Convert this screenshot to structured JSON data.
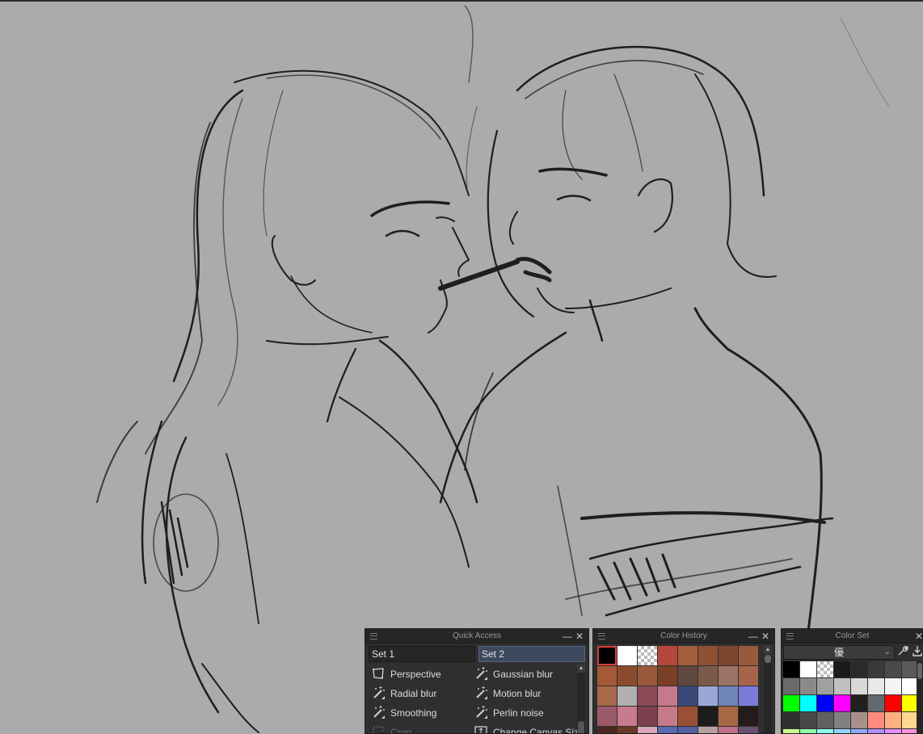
{
  "quick_access": {
    "title": "Quick Access",
    "minimize": "—",
    "close": "✕",
    "tabs": [
      "Set 1",
      "Set 2"
    ],
    "items": [
      {
        "label": "Perspective",
        "icon": "perspective-icon"
      },
      {
        "label": "Gaussian blur",
        "icon": "magic-wand-icon"
      },
      {
        "label": "Radial blur",
        "icon": "magic-wand-icon"
      },
      {
        "label": "Motion blur",
        "icon": "magic-wand-icon"
      },
      {
        "label": "Smoothing",
        "icon": "magic-wand-icon"
      },
      {
        "label": "Perlin noise",
        "icon": "magic-wand-icon"
      },
      {
        "label": "Crop",
        "icon": "crop-icon"
      },
      {
        "label": "Change Canvas Size",
        "icon": "canvas-size-icon"
      }
    ]
  },
  "color_history": {
    "title": "Color History",
    "minimize": "—",
    "close": "✕",
    "colors": [
      "#000000",
      "#ffffff",
      "transparent",
      "#b5473b",
      "#a45e3e",
      "#8e5133",
      "#7d4630",
      "#995a3c",
      "#a45a36",
      "#8b4c2e",
      "#9a5a3a",
      "#7a4025",
      "#5e4840",
      "#7c5a4a",
      "#9a7466",
      "#a8644a",
      "#a8694a",
      "#b0b0b0",
      "#8a4a58",
      "#c47a8a",
      "#3a4a78",
      "#9aa8d8",
      "#6f85b8",
      "#7a7ad8",
      "#9a5a6a",
      "#c87a8e",
      "#7a404e",
      "#c47a88",
      "#9a5034",
      "#1c1c1c",
      "#a86846",
      "#241c1c",
      "#4a2a20",
      "#6a3a28",
      "#d8a8b8",
      "#5a6ab0",
      "#5060a0",
      "#b8a0a0",
      "#c0708a",
      "#6a5070"
    ]
  },
  "color_set": {
    "title": "Color Set",
    "close": "✕",
    "set_name": "優",
    "tool_settings_icon": "wrench-icon",
    "tool_import_icon": "import-icon",
    "colors": [
      "#000000",
      "#ffffff",
      "transparent",
      "#1a1a1a",
      "#2a2a2a",
      "#3a3a3a",
      "#4a4a4a",
      "#5a5a5a",
      "#6a6a6a",
      "#8a8a8a",
      "#a0a0a0",
      "#c0c0c0",
      "#d8d8d8",
      "#e8e8e8",
      "#f4f4f4",
      "#ffffff",
      "#00ff00",
      "#00ffff",
      "#0000ff",
      "#ff00ff",
      "#202020",
      "#606a70",
      "#6a8aa8",
      "#a8b8c8",
      "#303030",
      "#484848",
      "#606060",
      "#808080",
      "#a89088",
      "#ff8a80",
      "#ffb080",
      "#ffd890",
      "#c8ff90",
      "#90ffa8",
      "#90fff0",
      "#90d8ff",
      "#90a8ff",
      "#b090ff",
      "#e090ff",
      "#ff90e0"
    ],
    "row3_extra": [
      "#ff0000",
      "#ffff00"
    ]
  }
}
